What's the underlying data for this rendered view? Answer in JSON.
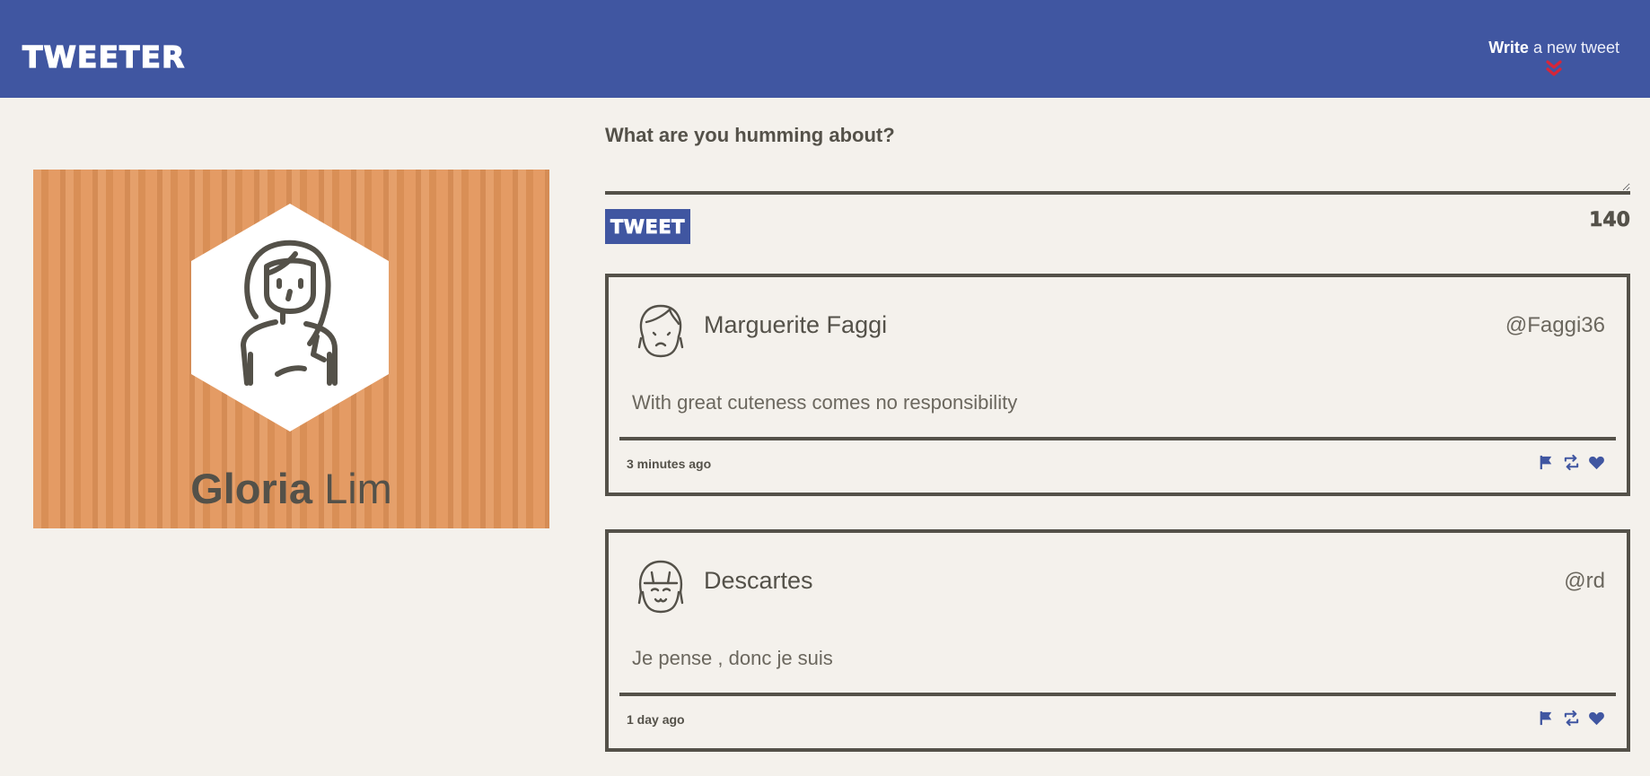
{
  "nav": {
    "brand": "TWEETER",
    "compose_toggle": {
      "bold": "Write",
      "rest": " a new tweet",
      "icon": "double-chevron-down-icon"
    }
  },
  "profile": {
    "first_name": "Gloria",
    "last_name": " Lim",
    "avatar_icon": "woman-avatar-icon"
  },
  "compose": {
    "heading": "What are you humming about?",
    "placeholder": "",
    "button_label": "TWEET",
    "counter": "140"
  },
  "tweets": [
    {
      "author": "Marguerite Faggi",
      "handle": "@Faggi36",
      "content": "With great cuteness comes no responsibility",
      "time": "3 minutes ago",
      "avatar_icon": "frowning-girl-avatar-icon"
    },
    {
      "author": "Descartes",
      "handle": "@rd",
      "content": "Je pense , donc je suis",
      "time": "1 day ago",
      "avatar_icon": "smiling-girl-avatar-icon"
    }
  ],
  "colors": {
    "nav_bg": "#4056a1",
    "page_bg": "#f4f1ec",
    "text": "#545149",
    "profile_bg": "#e2955a",
    "accent_red": "#d72638"
  }
}
